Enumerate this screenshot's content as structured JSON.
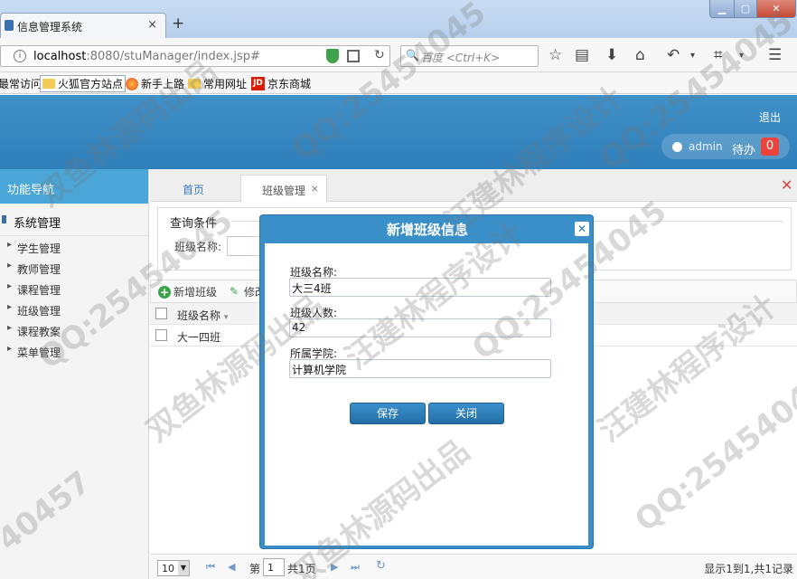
{
  "browser": {
    "tab_title": "信息管理系统",
    "tab_close": "×",
    "new_tab": "+",
    "url_host": "localhost",
    "url_path": ":8080/stuManager/index.jsp#",
    "search_placeholder": "百度 <Ctrl+K>",
    "bookmarks": [
      "最常访问",
      "火狐官方站点",
      "新手上路",
      "常用网址",
      "京东商城"
    ]
  },
  "header": {
    "logout": "退出",
    "user": "admin",
    "todo_label": "待办",
    "todo_count": "0"
  },
  "sidebar": {
    "title": "功能导航",
    "group": "系统管理",
    "items": [
      {
        "label": "学生管理"
      },
      {
        "label": "教师管理"
      },
      {
        "label": "课程管理"
      },
      {
        "label": "班级管理"
      },
      {
        "label": "课程教案"
      },
      {
        "label": "菜单管理"
      }
    ]
  },
  "main": {
    "tabs": [
      {
        "label": "首页"
      },
      {
        "label": "班级管理"
      }
    ],
    "query": {
      "title": "查询条件",
      "name_label": "班级名称:"
    },
    "toolbar": {
      "add": "新增班级",
      "edit": "修改"
    },
    "grid": {
      "header": "班级名称",
      "rows": [
        {
          "name": "大一四班"
        }
      ]
    },
    "pager": {
      "page_size": "10",
      "page_word": "第",
      "page": "1",
      "total": "共1页",
      "info": "显示1到1,共1记录"
    }
  },
  "modal": {
    "title": "新增班级信息",
    "fields": [
      {
        "label": "班级名称:",
        "value": "大三4班"
      },
      {
        "label": "班级人数:",
        "value": "42"
      },
      {
        "label": "所属学院:",
        "value": "计算机学院"
      }
    ],
    "save": "保存",
    "close": "关闭"
  },
  "watermarks": [
    "QQ:25454045",
    "双鱼林源码出品",
    "汪建林程序设计",
    "QQ:25454045",
    "双鱼林源码出品",
    "汪建林程序设计",
    "QQ:25454045",
    "QQ:25454045",
    "汪建林程序设计",
    "双鱼林源码出品",
    "QQ:25454045",
    "40457"
  ],
  "colors": {
    "header_blue": "#3588c3",
    "sidebar_head": "#4aa6d7",
    "modal_blue": "#3a8fc9",
    "badge_red": "#e9433a"
  }
}
